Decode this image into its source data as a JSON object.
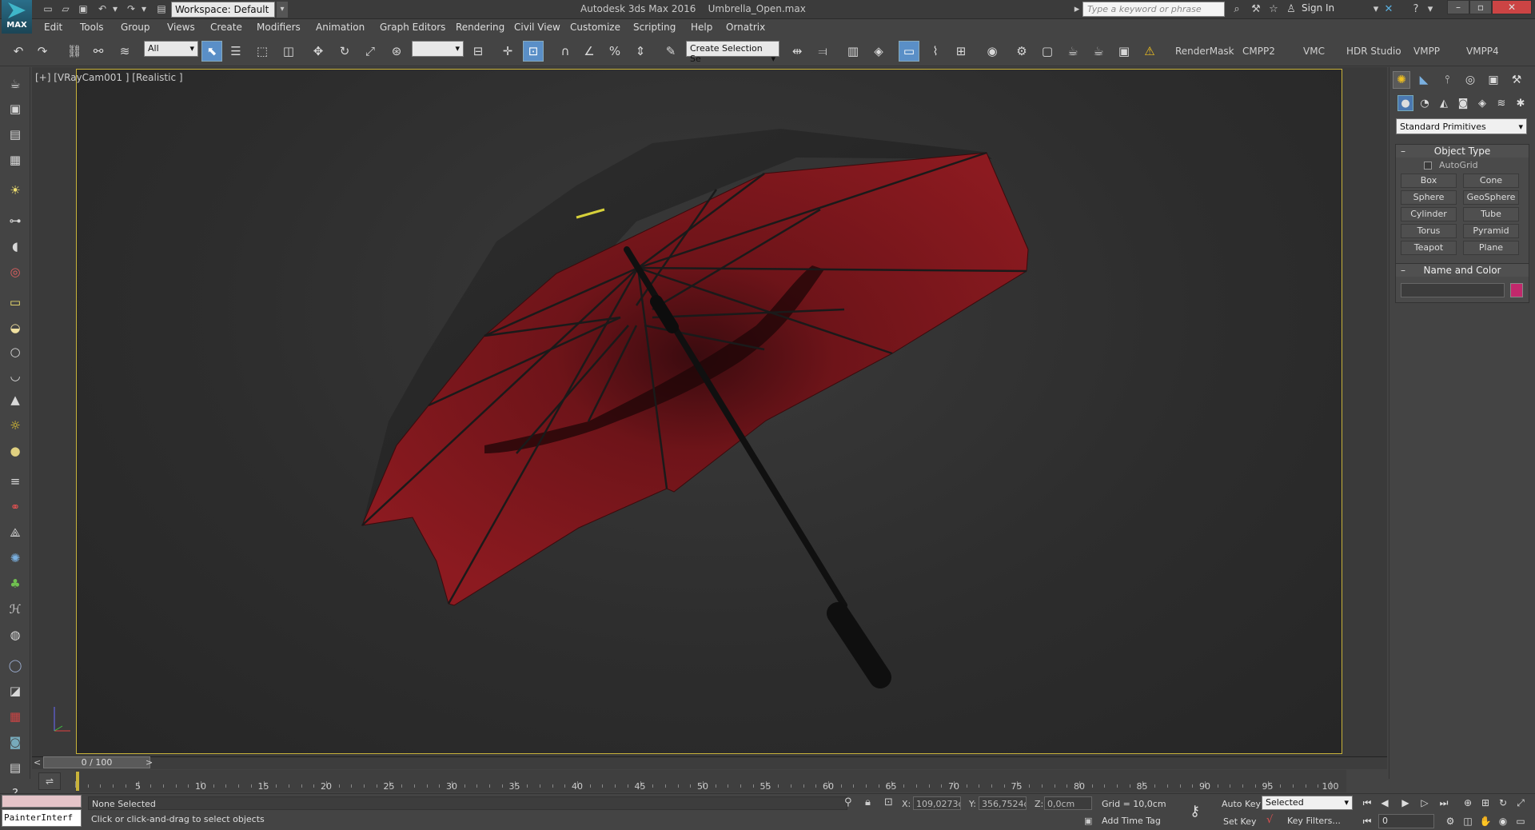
{
  "app": {
    "title": "Autodesk 3ds Max 2016",
    "file": "Umbrella_Open.max",
    "logo_text": "MAX",
    "workspace": "Workspace: Default",
    "search_placeholder": "Type a keyword or phrase",
    "sign_in": "Sign In"
  },
  "menus": [
    "Edit",
    "Tools",
    "Group",
    "Views",
    "Create",
    "Modifiers",
    "Animation",
    "Graph Editors",
    "Rendering",
    "Civil View",
    "Customize",
    "Scripting",
    "Help",
    "Ornatrix"
  ],
  "toolbar": {
    "selection_filter": "All",
    "named_selection": "Create Selection Se",
    "plugins": [
      "RenderMask",
      "CMPP2",
      "VMC",
      "HDR Studio",
      "VMPP",
      "VMPP4"
    ]
  },
  "viewport": {
    "label": "[+] [VRayCam001 ] [Realistic ]"
  },
  "command_panel": {
    "category": "Standard Primitives",
    "object_type": {
      "title": "Object Type",
      "autogrid": "AutoGrid",
      "buttons": [
        "Box",
        "Cone",
        "Sphere",
        "GeoSphere",
        "Cylinder",
        "Tube",
        "Torus",
        "Pyramid",
        "Teapot",
        "Plane"
      ]
    },
    "name_and_color": {
      "title": "Name and Color",
      "color": "#c2286c"
    }
  },
  "timeline": {
    "slider": "0 / 100",
    "ticks": [
      "5",
      "10",
      "15",
      "20",
      "25",
      "30",
      "35",
      "40",
      "45",
      "50",
      "55",
      "60",
      "65",
      "70",
      "75",
      "80",
      "85",
      "90",
      "95",
      "100"
    ]
  },
  "status": {
    "maxscript": "PainterInterf",
    "selection": "None Selected",
    "prompt": "Click or click-and-drag to select objects",
    "x_label": "X:",
    "x": "109,0273cm",
    "y_label": "Y:",
    "y": "356,7524cm",
    "z_label": "Z:",
    "z": "0,0cm",
    "grid": "Grid = 10,0cm",
    "add_time_tag": "Add Time Tag",
    "auto_key": "Auto Key",
    "set_key": "Set Key",
    "key_mode": "Selected",
    "key_filters": "Key Filters...",
    "frame": "0"
  }
}
